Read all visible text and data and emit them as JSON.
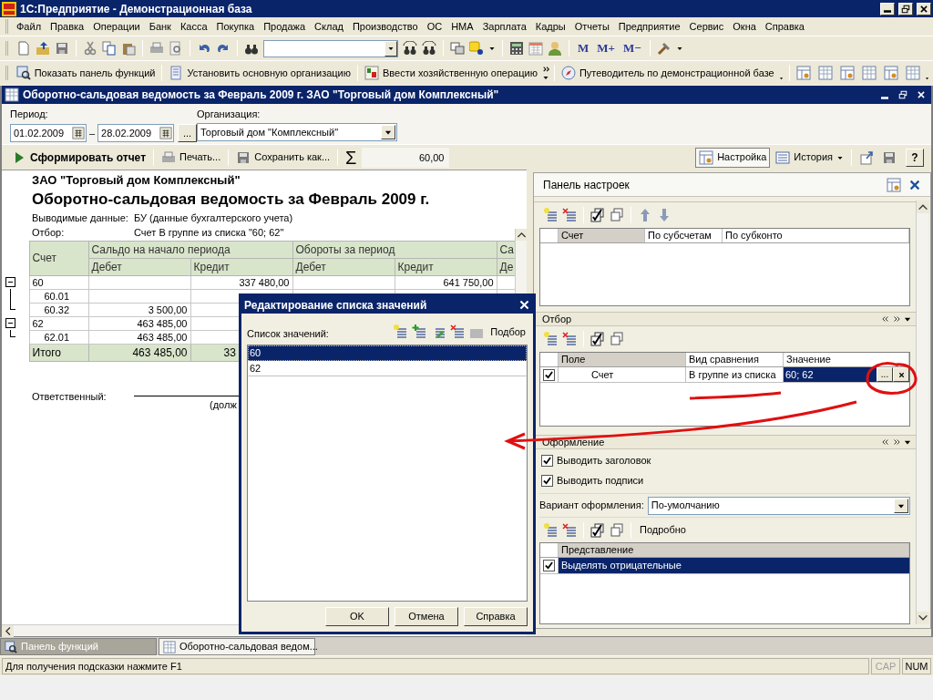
{
  "window": {
    "title": "1С:Предприятие - Демонстрационная база"
  },
  "menu": [
    "Файл",
    "Правка",
    "Операции",
    "Банк",
    "Касса",
    "Покупка",
    "Продажа",
    "Склад",
    "Производство",
    "ОС",
    "НМА",
    "Зарплата",
    "Кадры",
    "Отчеты",
    "Предприятие",
    "Сервис",
    "Окна",
    "Справка"
  ],
  "toolbar": {
    "memory_buttons": [
      "M",
      "M+",
      "M−"
    ]
  },
  "quick_bar": [
    "Показать панель функций",
    "Установить основную организацию",
    "Ввести хозяйственную операцию",
    "Путеводитель по демонстрационной базе"
  ],
  "document": {
    "title": "Оборотно-сальдовая ведомость за Февраль 2009 г. ЗАО \"Торговый дом Комплексный\"",
    "period_label": "Период:",
    "date_from": "01.02.2009",
    "date_separator": "–",
    "date_to": "28.02.2009",
    "period_button": "...",
    "organization_label": "Организация:",
    "organization": "Торговый дом \"Комплексный\""
  },
  "report_toolbar": {
    "generate": "Сформировать отчет",
    "print": "Печать...",
    "save": "Сохранить как...",
    "sum_symbol": "Σ",
    "sum": "60,00",
    "settings": {
      "label": "Настройка",
      "selected": true
    },
    "history": "История",
    "help": "?"
  },
  "report": {
    "organization": "ЗАО \"Торговый дом Комплексный\"",
    "heading": "Оборотно-сальдовая ведомость за Февраль 2009 г.",
    "info": [
      {
        "label": "Выводимые данные:",
        "value": "БУ (данные бухгалтерского учета)"
      },
      {
        "label": "Отбор:",
        "value": "Счет В группе из списка \"60; 62\""
      }
    ],
    "columns": [
      "Счет",
      "Сальдо на начало периода",
      "Обороты за период",
      "Са"
    ],
    "subcolumns": [
      "Дебет",
      "Кредит",
      "Дебет",
      "Кредит",
      "Де"
    ],
    "rows": [
      {
        "account": "60",
        "expanded": true,
        "credit_start": "337 480,00",
        "credit_turnover": "641 750,00",
        "children": [
          {
            "account": "60.01"
          },
          {
            "account": "60.32",
            "debit_start": "3 500,00"
          }
        ]
      },
      {
        "account": "62",
        "expanded": true,
        "debit_start": "463 485,00",
        "children": [
          {
            "account": "62.01",
            "debit_start": "463 485,00"
          }
        ]
      }
    ],
    "total": {
      "label": "Итого",
      "debit_start": "463 485,00",
      "credit_start": "33"
    },
    "signature": {
      "label": "Ответственный:",
      "caption": "(долж"
    }
  },
  "settings_panel": {
    "title": "Панель настроек",
    "grouping": {
      "columns": [
        "Счет",
        "По субсчетам",
        "По субконто"
      ]
    },
    "filter": {
      "title": "Отбор",
      "columns": [
        "Поле",
        "Вид сравнения",
        "Значение"
      ],
      "rows": [
        {
          "checked": true,
          "field": "Счет",
          "comparison": "В группе из списка",
          "value": "60; 62",
          "selected": true,
          "select_button": "..."
        }
      ]
    },
    "appearance": {
      "title": "Оформление",
      "options": [
        {
          "label": "Выводить заголовок",
          "checked": true
        },
        {
          "label": "Выводить подписи",
          "checked": true
        }
      ],
      "variant_label": "Вариант оформления:",
      "variant": "По-умолчанию",
      "detail_button": "Подробно",
      "column": "Представление",
      "rows": [
        {
          "checked": true,
          "text": "Выделять отрицательные",
          "selected": true
        }
      ]
    }
  },
  "dialog": {
    "title": "Редактирование списка значений",
    "list_label": "Список значений:",
    "pick_button": "Подбор",
    "items": [
      {
        "text": "60",
        "selected": true
      },
      {
        "text": "62",
        "selected": false
      }
    ],
    "buttons": [
      "OK",
      "Отмена",
      "Справка"
    ]
  },
  "taskbar": [
    {
      "label": "Панель функций",
      "selected": false
    },
    {
      "label": "Оборотно-сальдовая ведом...",
      "selected": true
    }
  ],
  "status_bar": {
    "hint": "Для получения подсказки нажмите F1",
    "indicators": [
      {
        "label": "CAP",
        "on": false
      },
      {
        "label": "NUM",
        "on": true
      }
    ]
  }
}
